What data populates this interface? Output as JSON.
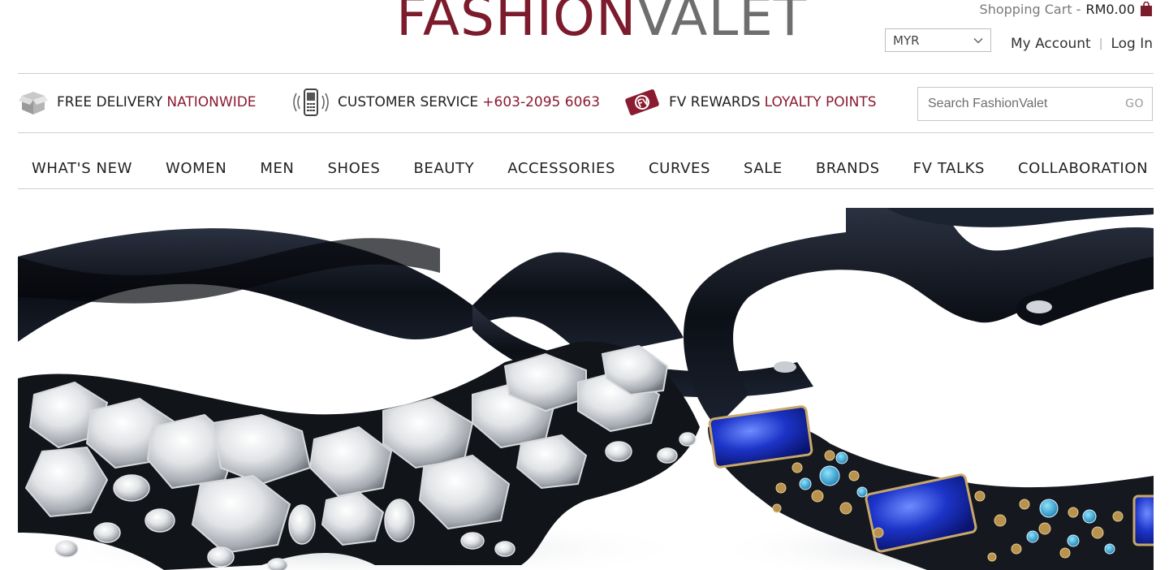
{
  "header": {
    "logo_part1": "FASHION",
    "logo_part2": "VALET",
    "cart_label": "Shopping Cart -",
    "cart_amount": "RM0.00",
    "currency": "MYR",
    "my_account": "My Account",
    "separator": "|",
    "login": "Log In"
  },
  "info_bar": {
    "delivery_text": "FREE DELIVERY",
    "delivery_highlight": "NATIONWIDE",
    "service_text": "CUSTOMER SERVICE",
    "service_phone": "+603-2095 6063",
    "rewards_text": "FV REWARDS",
    "rewards_highlight": "LOYALTY POINTS"
  },
  "search": {
    "placeholder": "Search FashionValet",
    "button": "GO"
  },
  "nav": {
    "items": [
      "WHAT'S NEW",
      "WOMEN",
      "MEN",
      "SHOES",
      "BEAUTY",
      "ACCESSORIES",
      "CURVES",
      "SALE",
      "BRANDS",
      "FV TALKS",
      "COLLABORATION"
    ]
  },
  "icons": {
    "delivery": "box-icon",
    "service": "phone-icon",
    "rewards": "fv-rewards-icon",
    "cart": "shopping-bag-icon",
    "currency_dropdown": "chevron-down-icon"
  },
  "colors": {
    "brand": "#7c1b2c",
    "highlight": "#8a1b30",
    "logo_grey": "#6e6e6e"
  }
}
